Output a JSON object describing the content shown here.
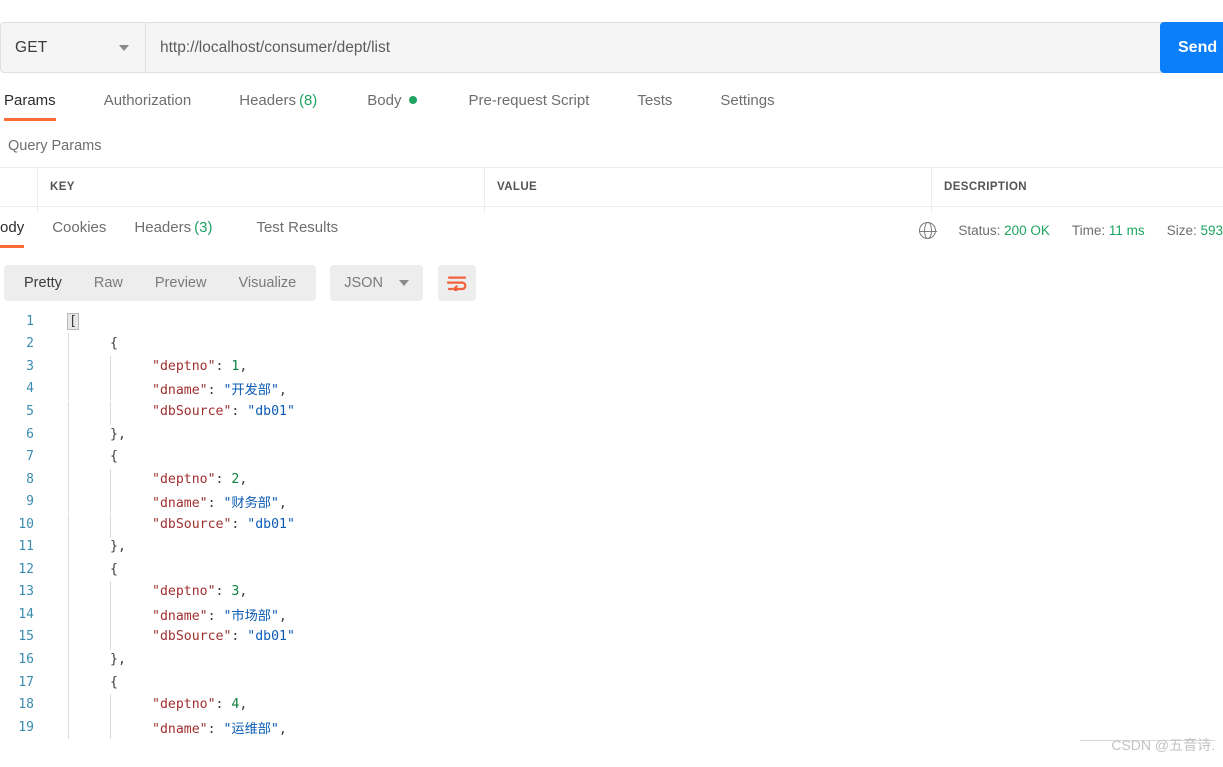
{
  "request": {
    "method": "GET",
    "url": "http://localhost/consumer/dept/list",
    "send_label": "Send",
    "method_caret_icon": "chevron-down-icon"
  },
  "request_tabs": [
    {
      "label": "Params",
      "count": null,
      "dot": false,
      "active": true
    },
    {
      "label": "Authorization",
      "count": null,
      "dot": false,
      "active": false
    },
    {
      "label": "Headers",
      "count": "(8)",
      "dot": false,
      "active": false
    },
    {
      "label": "Body",
      "count": null,
      "dot": true,
      "active": false
    },
    {
      "label": "Pre-request Script",
      "count": null,
      "dot": false,
      "active": false
    },
    {
      "label": "Tests",
      "count": null,
      "dot": false,
      "active": false
    },
    {
      "label": "Settings",
      "count": null,
      "dot": false,
      "active": false
    }
  ],
  "query_params": {
    "section_label": "Query Params",
    "columns": [
      "KEY",
      "VALUE",
      "DESCRIPTION"
    ],
    "rows": []
  },
  "response_tabs": [
    {
      "label": "Body",
      "count": null,
      "active": true
    },
    {
      "label": "Cookies",
      "count": null,
      "active": false
    },
    {
      "label": "Headers",
      "count": "(3)",
      "active": false
    },
    {
      "label": "Test Results",
      "count": null,
      "active": false
    }
  ],
  "response_meta": {
    "globe_icon": "globe-icon",
    "status_label": "Status:",
    "status_value": "200 OK",
    "time_label": "Time:",
    "time_value": "11 ms",
    "size_label": "Size:",
    "size_value": "593"
  },
  "view_toolbar": {
    "modes": [
      {
        "label": "Pretty",
        "active": true
      },
      {
        "label": "Raw",
        "active": false
      },
      {
        "label": "Preview",
        "active": false
      },
      {
        "label": "Visualize",
        "active": false
      }
    ],
    "format": "JSON",
    "format_caret_icon": "chevron-down-icon",
    "wrap_icon": "word-wrap-icon"
  },
  "colors": {
    "accent_orange": "#ff6c37",
    "send_blue": "#0b7ffb",
    "status_green": "#1fa462",
    "json_key": "#a03030",
    "json_string": "#0b5bb5",
    "json_number": "#108040",
    "line_number": "#3a8cb0"
  },
  "code": {
    "lines": [
      {
        "no": "1",
        "indent": 0,
        "tokens": [
          {
            "t": "[",
            "c": "hl"
          }
        ]
      },
      {
        "no": "2",
        "indent": 1,
        "tokens": [
          {
            "t": "{",
            "c": "p"
          }
        ]
      },
      {
        "no": "3",
        "indent": 2,
        "tokens": [
          {
            "t": "\"deptno\"",
            "c": "k"
          },
          {
            "t": ": ",
            "c": "p"
          },
          {
            "t": "1",
            "c": "n"
          },
          {
            "t": ",",
            "c": "p"
          }
        ]
      },
      {
        "no": "4",
        "indent": 2,
        "tokens": [
          {
            "t": "\"dname\"",
            "c": "k"
          },
          {
            "t": ": ",
            "c": "p"
          },
          {
            "t": "\"开发部\"",
            "c": "s"
          },
          {
            "t": ",",
            "c": "p"
          }
        ]
      },
      {
        "no": "5",
        "indent": 2,
        "tokens": [
          {
            "t": "\"dbSource\"",
            "c": "k"
          },
          {
            "t": ": ",
            "c": "p"
          },
          {
            "t": "\"db01\"",
            "c": "s"
          }
        ]
      },
      {
        "no": "6",
        "indent": 1,
        "tokens": [
          {
            "t": "},",
            "c": "p"
          }
        ]
      },
      {
        "no": "7",
        "indent": 1,
        "tokens": [
          {
            "t": "{",
            "c": "p"
          }
        ]
      },
      {
        "no": "8",
        "indent": 2,
        "tokens": [
          {
            "t": "\"deptno\"",
            "c": "k"
          },
          {
            "t": ": ",
            "c": "p"
          },
          {
            "t": "2",
            "c": "n"
          },
          {
            "t": ",",
            "c": "p"
          }
        ]
      },
      {
        "no": "9",
        "indent": 2,
        "tokens": [
          {
            "t": "\"dname\"",
            "c": "k"
          },
          {
            "t": ": ",
            "c": "p"
          },
          {
            "t": "\"财务部\"",
            "c": "s"
          },
          {
            "t": ",",
            "c": "p"
          }
        ]
      },
      {
        "no": "10",
        "indent": 2,
        "tokens": [
          {
            "t": "\"dbSource\"",
            "c": "k"
          },
          {
            "t": ": ",
            "c": "p"
          },
          {
            "t": "\"db01\"",
            "c": "s"
          }
        ]
      },
      {
        "no": "11",
        "indent": 1,
        "tokens": [
          {
            "t": "},",
            "c": "p"
          }
        ]
      },
      {
        "no": "12",
        "indent": 1,
        "tokens": [
          {
            "t": "{",
            "c": "p"
          }
        ]
      },
      {
        "no": "13",
        "indent": 2,
        "tokens": [
          {
            "t": "\"deptno\"",
            "c": "k"
          },
          {
            "t": ": ",
            "c": "p"
          },
          {
            "t": "3",
            "c": "n"
          },
          {
            "t": ",",
            "c": "p"
          }
        ]
      },
      {
        "no": "14",
        "indent": 2,
        "tokens": [
          {
            "t": "\"dname\"",
            "c": "k"
          },
          {
            "t": ": ",
            "c": "p"
          },
          {
            "t": "\"市场部\"",
            "c": "s"
          },
          {
            "t": ",",
            "c": "p"
          }
        ]
      },
      {
        "no": "15",
        "indent": 2,
        "tokens": [
          {
            "t": "\"dbSource\"",
            "c": "k"
          },
          {
            "t": ": ",
            "c": "p"
          },
          {
            "t": "\"db01\"",
            "c": "s"
          }
        ]
      },
      {
        "no": "16",
        "indent": 1,
        "tokens": [
          {
            "t": "},",
            "c": "p"
          }
        ]
      },
      {
        "no": "17",
        "indent": 1,
        "tokens": [
          {
            "t": "{",
            "c": "p"
          }
        ]
      },
      {
        "no": "18",
        "indent": 2,
        "tokens": [
          {
            "t": "\"deptno\"",
            "c": "k"
          },
          {
            "t": ": ",
            "c": "p"
          },
          {
            "t": "4",
            "c": "n"
          },
          {
            "t": ",",
            "c": "p"
          }
        ]
      },
      {
        "no": "19",
        "indent": 2,
        "tokens": [
          {
            "t": "\"dname\"",
            "c": "k"
          },
          {
            "t": ": ",
            "c": "p"
          },
          {
            "t": "\"运维部\"",
            "c": "s"
          },
          {
            "t": ",",
            "c": "p"
          }
        ]
      }
    ]
  },
  "watermark": {
    "text": "CSDN @五音诗."
  }
}
